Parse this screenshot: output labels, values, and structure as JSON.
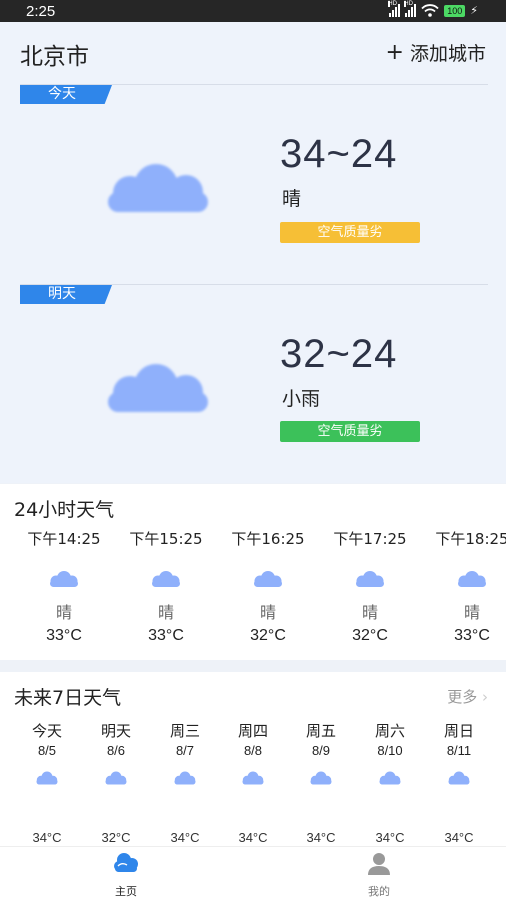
{
  "status_bar": {
    "time": "2:25",
    "battery": "100",
    "network_label": "HD"
  },
  "header": {
    "city": "北京市",
    "add_city": "添加城市",
    "add_icon": "plus-icon"
  },
  "colors": {
    "accent": "#2f86ea",
    "cloud": "#8fb0fb",
    "aqi_yellow": "#f6bf36",
    "aqi_green": "#3cc15a"
  },
  "today": {
    "tag": "今天",
    "temp": "34~24",
    "condition": "晴",
    "aqi": "空气质量劣"
  },
  "tomorrow": {
    "tag": "明天",
    "temp": "32~24",
    "condition": "小雨",
    "aqi": "空气质量劣"
  },
  "hourly": {
    "title": "24小时天气",
    "items": [
      {
        "time": "下午14:25",
        "weather": "晴",
        "temp": "33°C"
      },
      {
        "time": "下午15:25",
        "weather": "晴",
        "temp": "33°C"
      },
      {
        "time": "下午16:25",
        "weather": "晴",
        "temp": "32°C"
      },
      {
        "time": "下午17:25",
        "weather": "晴",
        "temp": "32°C"
      },
      {
        "time": "下午18:25",
        "weather": "晴",
        "temp": "33°C"
      }
    ]
  },
  "weekly": {
    "title": "未来7日天气",
    "more": "更多",
    "days": [
      {
        "name": "今天",
        "date": "8/5",
        "temp": "34°C"
      },
      {
        "name": "明天",
        "date": "8/6",
        "temp": "32°C"
      },
      {
        "name": "周三",
        "date": "8/7",
        "temp": "34°C"
      },
      {
        "name": "周四",
        "date": "8/8",
        "temp": "34°C"
      },
      {
        "name": "周五",
        "date": "8/9",
        "temp": "34°C"
      },
      {
        "name": "周六",
        "date": "8/10",
        "temp": "34°C"
      },
      {
        "name": "周日",
        "date": "8/11",
        "temp": "34°C"
      }
    ]
  },
  "nav": {
    "home": "主页",
    "me": "我的"
  }
}
